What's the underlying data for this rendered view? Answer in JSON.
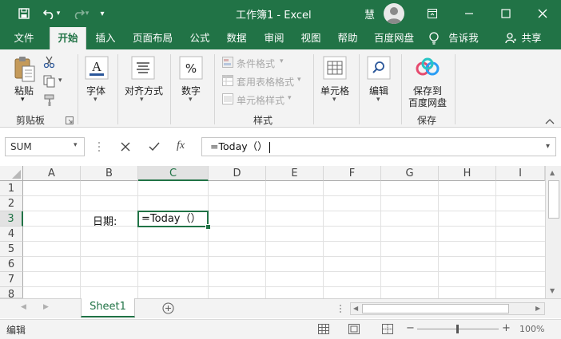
{
  "window": {
    "title": "工作簿1  -  Excel",
    "user": "慧"
  },
  "menu": {
    "tabs": [
      "文件",
      "开始",
      "插入",
      "页面布局",
      "公式",
      "数据",
      "审阅",
      "视图",
      "帮助",
      "百度网盘",
      "告诉我",
      "共享"
    ],
    "active": "开始"
  },
  "ribbon": {
    "clipboard": {
      "paste": "粘贴",
      "group": "剪贴板"
    },
    "font": {
      "label": "字体"
    },
    "alignment": {
      "label": "对齐方式"
    },
    "number": {
      "label": "数字"
    },
    "styles": {
      "conditional": "条件格式",
      "table_format": "套用表格格式",
      "cell_styles": "单元格样式",
      "group": "样式"
    },
    "cells": {
      "label": "单元格"
    },
    "editing": {
      "label": "编辑"
    },
    "save": {
      "line1": "保存到",
      "line2": "百度网盘",
      "group": "保存"
    }
  },
  "formula_bar": {
    "name_box": "SUM",
    "formula": "=Today（）"
  },
  "grid": {
    "columns": [
      "A",
      "B",
      "C",
      "D",
      "E",
      "F",
      "G",
      "H",
      "I"
    ],
    "rows": [
      "1",
      "2",
      "3",
      "4",
      "5",
      "6",
      "7",
      "8"
    ],
    "active_column": "C",
    "active_row": "3",
    "cells": {
      "B3": "日期:",
      "C3": "=Today（）"
    }
  },
  "sheets": {
    "tabs": [
      "Sheet1"
    ],
    "active": "Sheet1"
  },
  "status": {
    "mode": "编辑",
    "zoom": "100%"
  },
  "colors": {
    "brand": "#217346",
    "ribbon_bg": "#f3f3f3",
    "active_header": "#e2e2e2"
  }
}
